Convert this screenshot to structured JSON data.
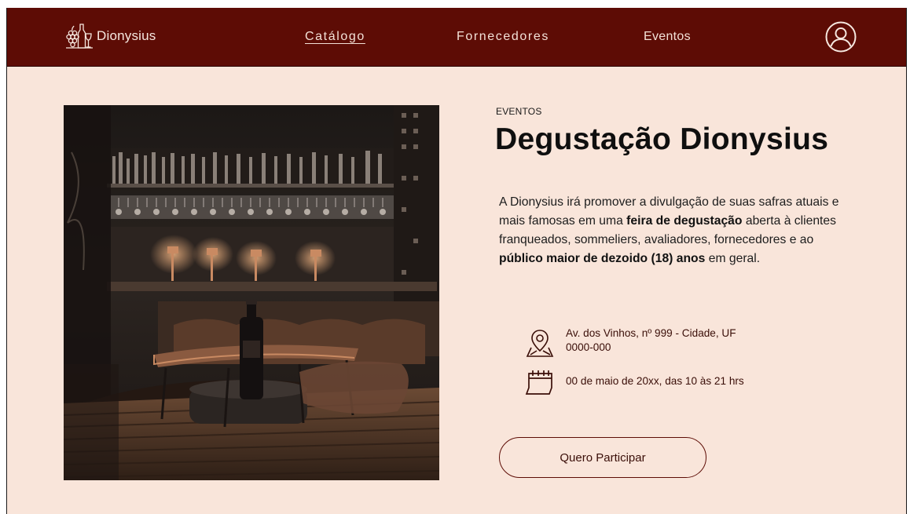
{
  "nav": {
    "brand": "Dionysius",
    "links": [
      {
        "label": "Catálogo",
        "active": true
      },
      {
        "label": "Fornecedores",
        "active": false
      },
      {
        "label": "Eventos",
        "active": false
      }
    ]
  },
  "event": {
    "category": "EVENTOS",
    "title": "Degustação Dionysius",
    "description": {
      "p1": "A Dionysius irá promover a divulgação de suas safras atuais e mais famosas em uma ",
      "b1": "feira de degustação",
      "p2": " aberta à clientes franqueados, sommeliers, avaliadores, fornecedores e ao ",
      "b2": "público maior de dezoido (18) anos",
      "p3": " em geral."
    },
    "address_line1": "Av. dos Vinhos, nº 999 - Cidade, UF",
    "address_line2": "0000-000",
    "date": "00 de maio de 20xx, das 10 às 21 hrs",
    "cta": "Quero Participar"
  },
  "icons": {
    "brand": "wine-grape-logo-icon",
    "user": "user-profile-icon",
    "location": "map-pin-icon",
    "calendar": "calendar-icon"
  },
  "colors": {
    "navbar": "#5d0c05",
    "background": "#f9e5da",
    "accent": "#5d0c05",
    "text_dark": "#0f0f0f"
  }
}
